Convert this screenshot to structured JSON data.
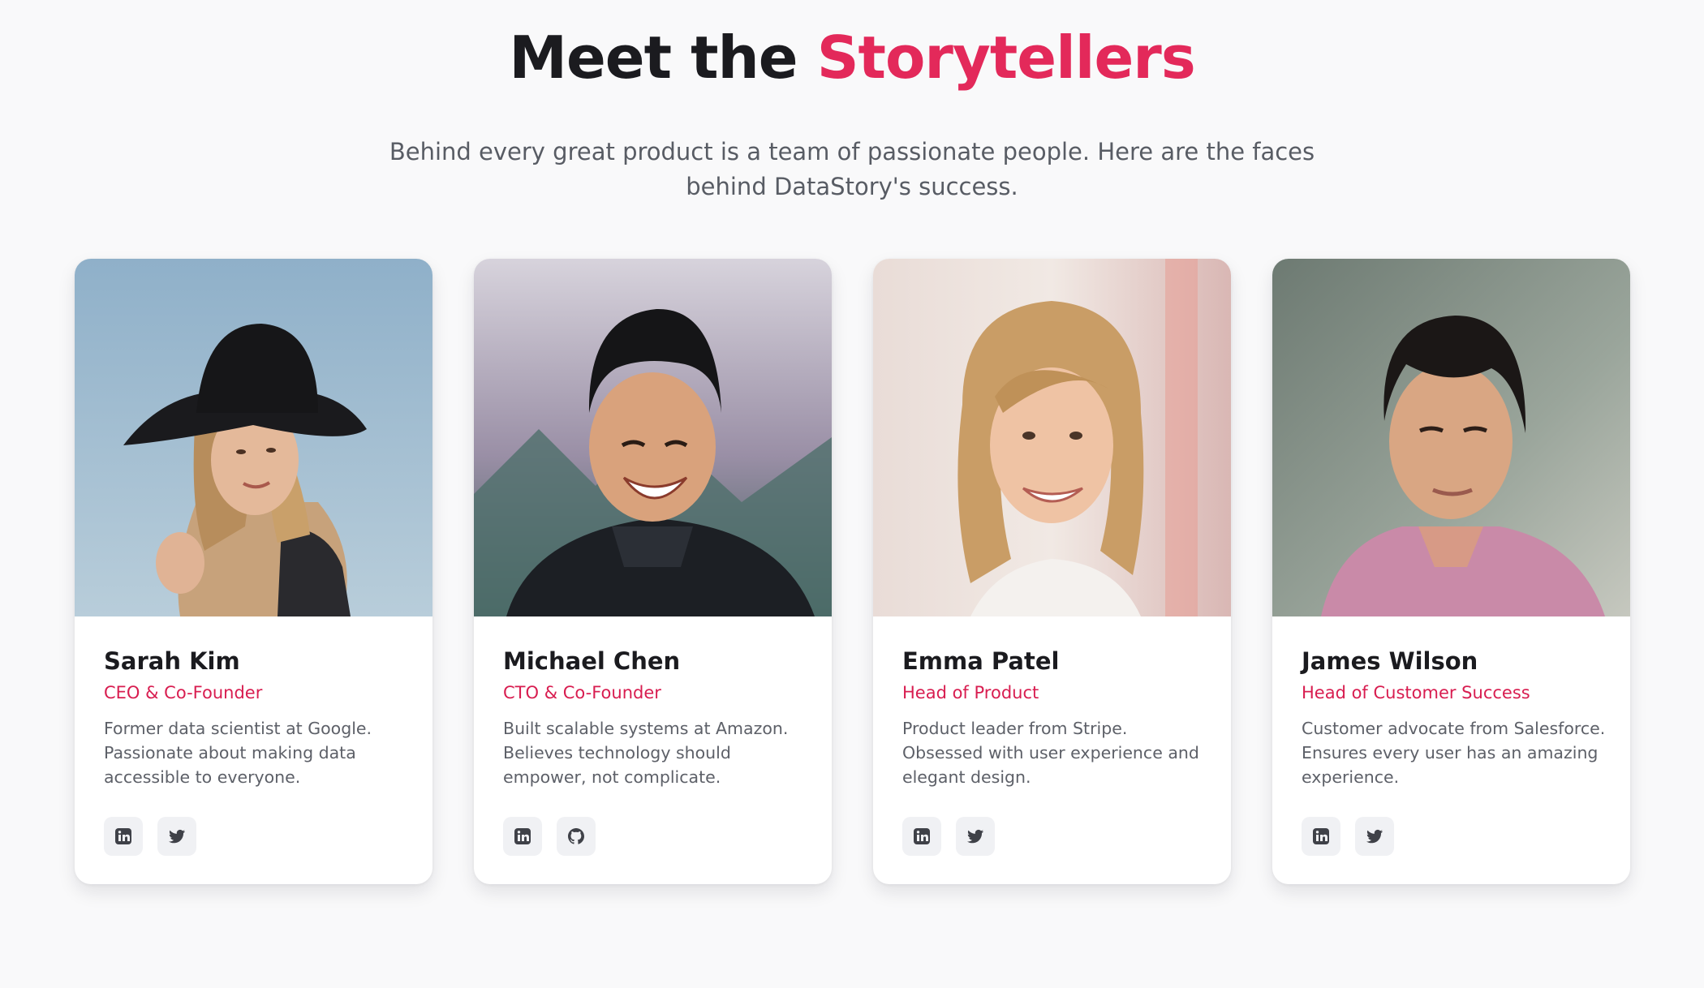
{
  "header": {
    "title_prefix": "Meet the ",
    "title_accent": "Storytellers",
    "subtitle": "Behind every great product is a team of passionate people. Here are the faces behind DataStory's success."
  },
  "colors": {
    "accent": "#e3295a",
    "role_text": "#d81d50",
    "background": "#f9f9fa",
    "card": "#ffffff"
  },
  "team": [
    {
      "name": "Sarah Kim",
      "role": "CEO & Co-Founder",
      "bio": "Former data scientist at Google. Passionate about making data accessible to everyone.",
      "photo": "portrait-woman-black-hat",
      "socials": [
        "linkedin-icon",
        "twitter-icon"
      ]
    },
    {
      "name": "Michael Chen",
      "role": "CTO & Co-Founder",
      "bio": "Built scalable systems at Amazon. Believes technology should empower, not complicate.",
      "photo": "portrait-man-mountains",
      "socials": [
        "linkedin-icon",
        "github-icon"
      ]
    },
    {
      "name": "Emma Patel",
      "role": "Head of Product",
      "bio": "Product leader from Stripe. Obsessed with user experience and elegant design.",
      "photo": "portrait-woman-blonde",
      "socials": [
        "linkedin-icon",
        "twitter-icon"
      ]
    },
    {
      "name": "James Wilson",
      "role": "Head of Customer Success",
      "bio": "Customer advocate from Salesforce. Ensures every user has an amazing experience.",
      "photo": "portrait-man-pink-shirt",
      "socials": [
        "linkedin-icon",
        "twitter-icon"
      ]
    }
  ]
}
